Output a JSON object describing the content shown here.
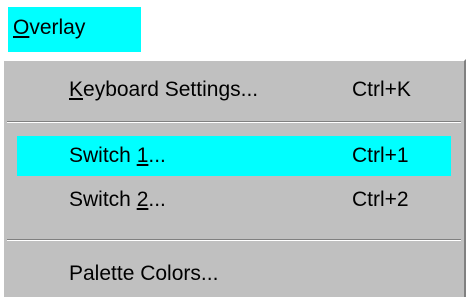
{
  "colors": {
    "highlight": "#00ffff",
    "panel": "#c0c0c0"
  },
  "menu": {
    "title": {
      "mnemonic": "O",
      "rest": "verlay"
    },
    "items": [
      {
        "pre": "",
        "mnemonic": "K",
        "post": "eyboard Settings...",
        "shortcut": "Ctrl+K"
      },
      {
        "pre": "Switch ",
        "mnemonic": "1",
        "post": "...",
        "shortcut": "Ctrl+1",
        "highlighted": true
      },
      {
        "pre": "Switch ",
        "mnemonic": "2",
        "post": "...",
        "shortcut": "Ctrl+2"
      },
      {
        "pre": "",
        "mnemonic": "",
        "post": "Palette Colors...",
        "shortcut": ""
      }
    ]
  }
}
